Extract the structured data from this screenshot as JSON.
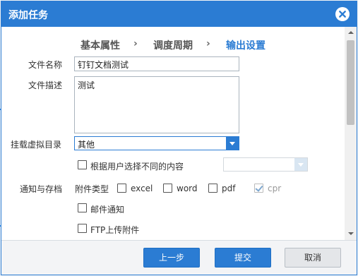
{
  "dialog": {
    "title": "添加任务"
  },
  "steps": [
    {
      "label": "基本属性"
    },
    {
      "label": "调度周期"
    },
    {
      "label": "输出设置"
    }
  ],
  "step_separator": "›",
  "form": {
    "file_name_label": "文件名称",
    "file_name_value": "钉钉文档测试",
    "file_desc_label": "文件描述",
    "file_desc_value": "测试",
    "mount_dir_label": "挂载虚拟目录",
    "mount_dir_value": "其他",
    "by_user_choice_label": "根据用户选择不同的内容",
    "notify_storage_label": "通知与存档",
    "attachment_type_label": "附件类型",
    "attachment_types": [
      {
        "label": "excel",
        "checked": false
      },
      {
        "label": "word",
        "checked": false
      },
      {
        "label": "pdf",
        "checked": false
      },
      {
        "label": "cpr",
        "checked": true
      }
    ],
    "email_notify_label": "邮件通知",
    "ftp_upload_label": "FTP上传附件"
  },
  "footer": {
    "prev_label": "上一步",
    "submit_label": "提交",
    "cancel_label": "取消"
  },
  "colors": {
    "accent": "#2b7cd3",
    "title_bg": "#2b7cd3",
    "footer_bg": "#f3f4f6"
  }
}
